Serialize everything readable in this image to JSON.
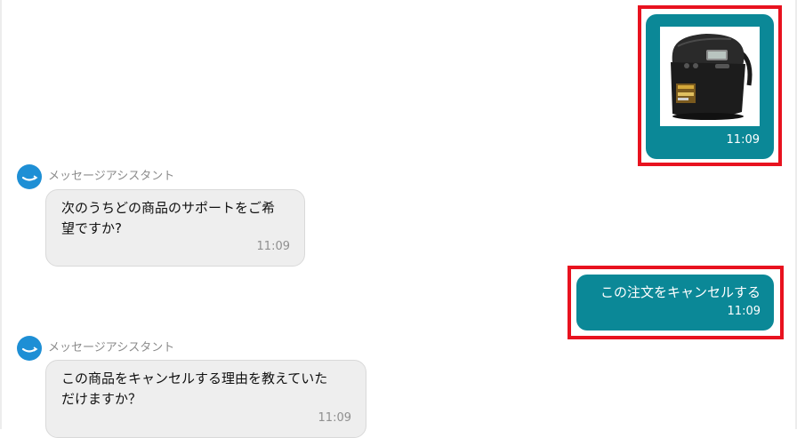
{
  "messages": [
    {
      "type": "user_image",
      "image_icon": "rice-cooker-product-image",
      "time": "11:09"
    },
    {
      "type": "bot",
      "sender": "メッセージアシスタント",
      "line1": "次のうちどの商品のサポートをご希",
      "line2": "望ですか?",
      "time": "11:09"
    },
    {
      "type": "user_text",
      "text": "この注文をキャンセルする",
      "time": "11:09"
    },
    {
      "type": "bot",
      "sender": "メッセージアシスタント",
      "line1": "この商品をキャンセルする理由を教えていた",
      "line2": "だけますか？",
      "time": "11:09"
    }
  ],
  "colors": {
    "user_bubble": "#0b8897",
    "bot_bubble": "#eeeeee",
    "highlight": "#e8121f",
    "avatar": "#1e8fd5"
  }
}
